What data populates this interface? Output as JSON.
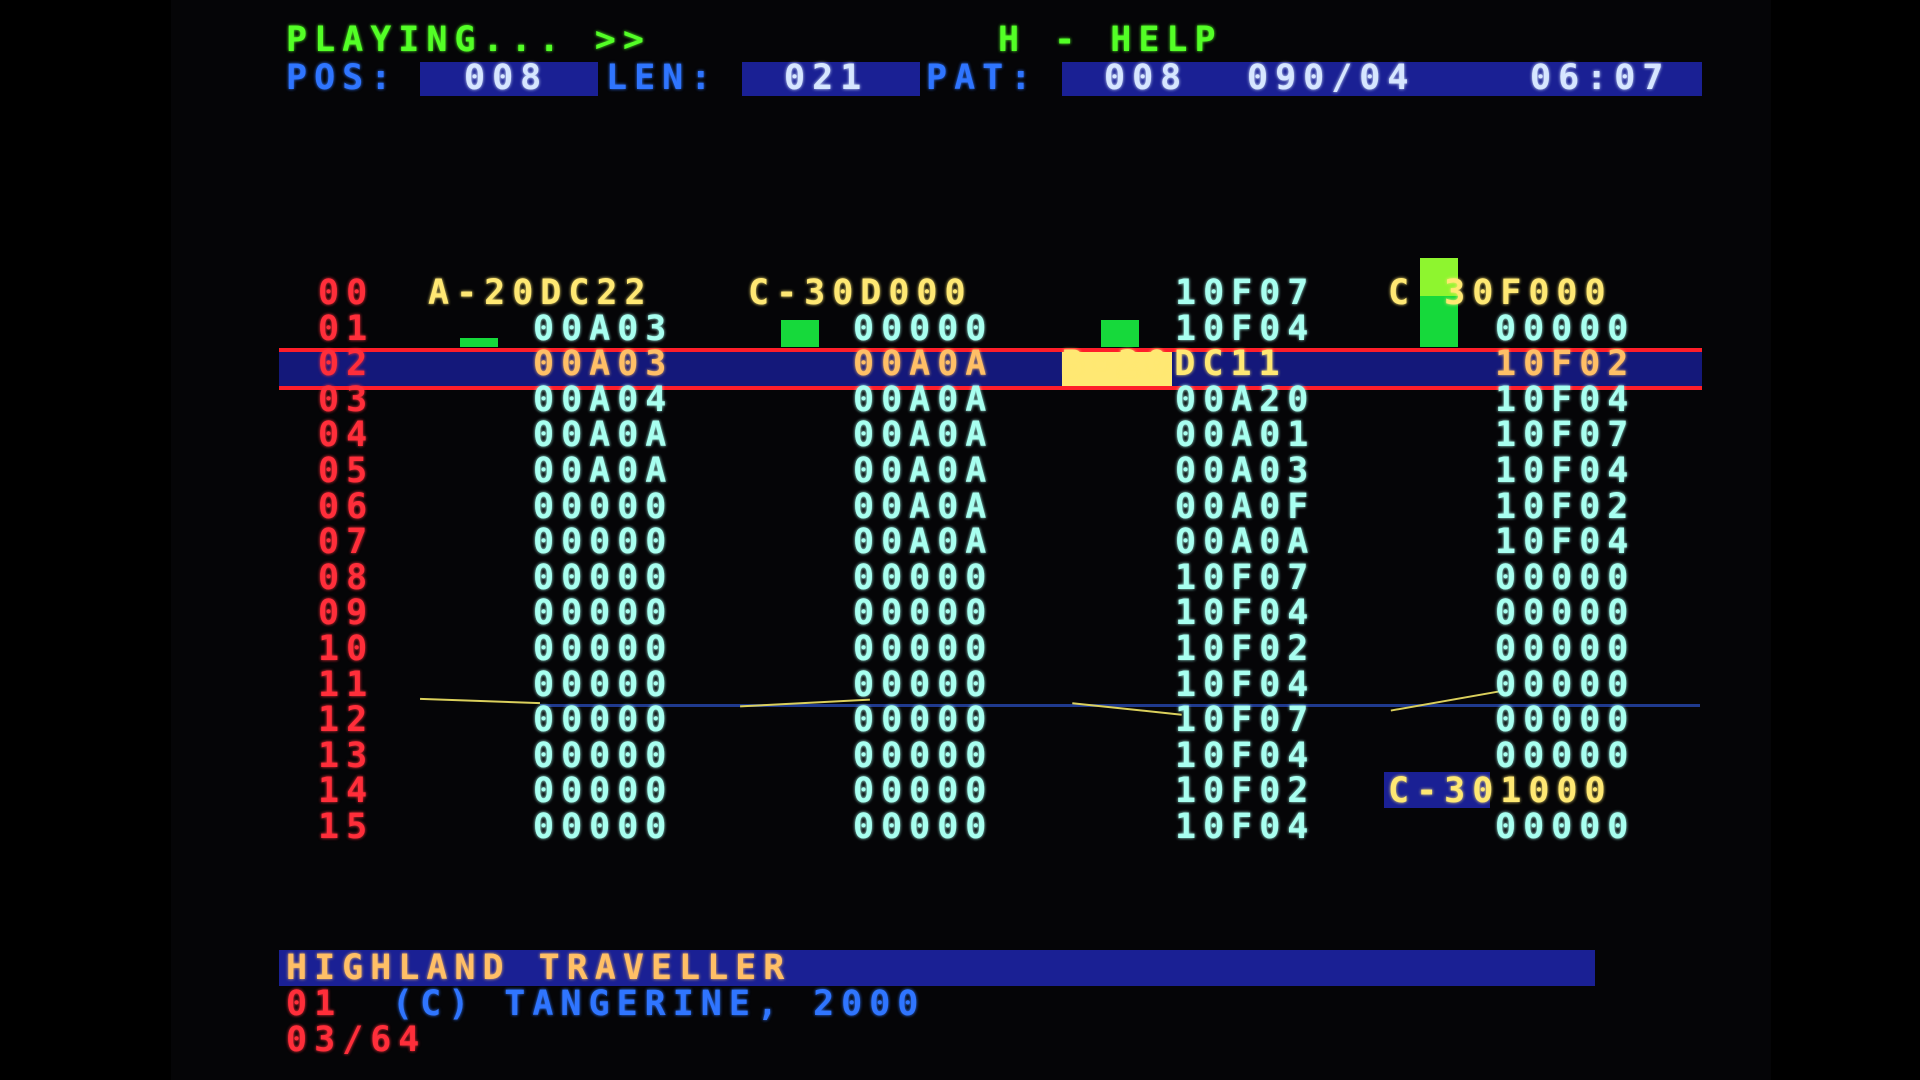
{
  "status": {
    "playing": "PLAYING... >>",
    "help": "H - HELP"
  },
  "info": {
    "pos_label": "POS:",
    "pos_value": "008",
    "len_label": "LEN:",
    "len_value": "021",
    "pat_label": "PAT:",
    "pat_value": "008",
    "tempo": "090/04",
    "time": "06:07"
  },
  "pattern": {
    "rows": [
      {
        "num": "00",
        "ch1": "A-20DC22",
        "ch2": "C-30D000",
        "ch3": "10F07",
        "ch4": "C 30F000"
      },
      {
        "num": "01",
        "ch1": "00A03",
        "ch2": "00000",
        "ch3": "10F04",
        "ch4": "00000"
      },
      {
        "num": "02",
        "ch1": "00A03",
        "ch2": "00A0A",
        "ch3": "B-20DC11",
        "ch4": "10F02"
      },
      {
        "num": "03",
        "ch1": "00A04",
        "ch2": "00A0A",
        "ch3": "00A20",
        "ch4": "10F04"
      },
      {
        "num": "04",
        "ch1": "00A0A",
        "ch2": "00A0A",
        "ch3": "00A01",
        "ch4": "10F07"
      },
      {
        "num": "05",
        "ch1": "00A0A",
        "ch2": "00A0A",
        "ch3": "00A03",
        "ch4": "10F04"
      },
      {
        "num": "06",
        "ch1": "00000",
        "ch2": "00A0A",
        "ch3": "00A0F",
        "ch4": "10F02"
      },
      {
        "num": "07",
        "ch1": "00000",
        "ch2": "00A0A",
        "ch3": "00A0A",
        "ch4": "10F04"
      },
      {
        "num": "08",
        "ch1": "00000",
        "ch2": "00000",
        "ch3": "10F07",
        "ch4": "00000"
      },
      {
        "num": "09",
        "ch1": "00000",
        "ch2": "00000",
        "ch3": "10F04",
        "ch4": "00000"
      },
      {
        "num": "10",
        "ch1": "00000",
        "ch2": "00000",
        "ch3": "10F02",
        "ch4": "00000"
      },
      {
        "num": "11",
        "ch1": "00000",
        "ch2": "00000",
        "ch3": "10F04",
        "ch4": "00000"
      },
      {
        "num": "12",
        "ch1": "00000",
        "ch2": "00000",
        "ch3": "10F07",
        "ch4": "00000"
      },
      {
        "num": "13",
        "ch1": "00000",
        "ch2": "00000",
        "ch3": "10F04",
        "ch4": "00000"
      },
      {
        "num": "14",
        "ch1": "00000",
        "ch2": "00000",
        "ch3": "10F02",
        "ch4": "C-301000"
      },
      {
        "num": "15",
        "ch1": "00000",
        "ch2": "00000",
        "ch3": "10F04",
        "ch4": "00000"
      }
    ],
    "highlight_row": "02"
  },
  "song": {
    "title": "HIGHLAND TRAVELLER",
    "credit_num": "01",
    "credit": "(C) TANGERINE, 2000",
    "count": "03/64"
  },
  "colors": {
    "status_green": "#53ff26",
    "label_blue": "#2f75ff",
    "box_blue": "#1a2094",
    "row_red": "#ff2e3a",
    "data_cyan": "#a8fff0",
    "note_yellow": "#ffe873",
    "meter_green": "#16d93b"
  }
}
